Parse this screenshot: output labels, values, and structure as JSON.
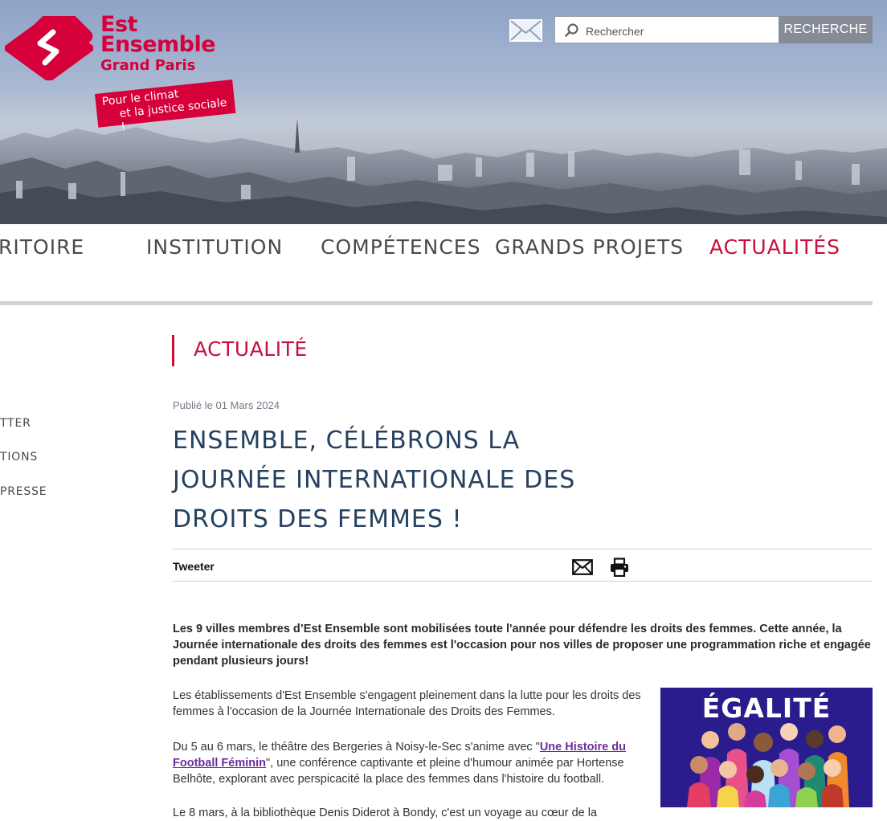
{
  "header": {
    "logo_line1": "Est",
    "logo_line2": "Ensemble",
    "logo_line3": "Grand Paris",
    "slogan_line1": "Pour le climat",
    "slogan_line2": "et la justice sociale !",
    "search_placeholder": "Rechercher",
    "search_button": "RECHERCHE",
    "brand_color": "#d6003b"
  },
  "nav": {
    "items": [
      {
        "label": "TERRITOIRE",
        "visible_text": "RITOIRE"
      },
      {
        "label": "INSTITUTION"
      },
      {
        "label": "COMPÉTENCES"
      },
      {
        "label": "GRANDS PROJETS"
      },
      {
        "label": "ACTUALITÉS",
        "active": true
      }
    ]
  },
  "sidebar": {
    "items": [
      "TTER",
      "TIONS",
      "PRESSE"
    ]
  },
  "main": {
    "section_title": "ACTUALITÉ",
    "published": "Publié le 01 Mars 2024",
    "headline": "ENSEMBLE, CÉLÉBRONS LA JOURNÉE INTERNATIONALE DES DROITS DES FEMMES !",
    "tweet_label": "Tweeter",
    "intro": "Les 9 villes membres d’Est Ensemble sont mobilisées toute l'année pour défendre les droits des femmes. Cette année, la Journée internationale des droits des femmes est l'occasion pour nos villes de proposer une programmation riche et engagée pendant plusieurs jours!",
    "para1": "Les établissements d'Est Ensemble s'engagent pleinement dans la lutte pour les droits des femmes à l'occasion de la Journée Internationale des Droits des Femmes.",
    "para2_before": "Du 5 au 6 mars, le théâtre des Bergeries à Noisy-le-Sec s'anime avec \"",
    "para2_link": "Une Histoire du Football Féminin",
    "para2_after": "\", une conférence captivante et pleine d'humour animée par Hortense Belhôte, explorant avec perspicacité la place des femmes dans l'histoire du football.",
    "para3": "Le 8 mars, à la bibliothèque Denis Diderot à Bondy, c'est un voyage au cœur de la",
    "image_text": "ÉGALITÉ",
    "accent_color": "#c8103e",
    "headline_color": "#25415f",
    "link_color": "#6c2b9c"
  }
}
